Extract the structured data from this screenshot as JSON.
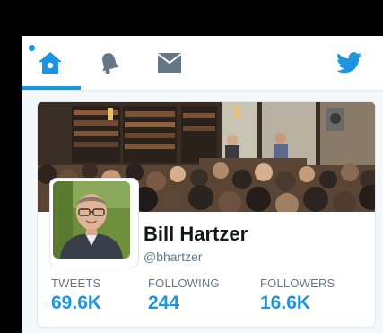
{
  "nav": {
    "items": [
      {
        "icon": "home-icon",
        "active": true
      },
      {
        "icon": "bell-icon",
        "active": false
      },
      {
        "icon": "envelope-icon",
        "active": false
      }
    ],
    "logo_icon": "twitter-bird-icon"
  },
  "colors": {
    "accent": "#1b95e0",
    "text_dark": "#14171a",
    "text_muted": "#657786",
    "nav_icon": "#657786",
    "background": "#000000"
  },
  "profile": {
    "name": "Bill Hartzer",
    "handle": "@bhartzer"
  },
  "stats": [
    {
      "label": "TWEETS",
      "value": "69.6K"
    },
    {
      "label": "FOLLOWING",
      "value": "244"
    },
    {
      "label": "FOLLOWERS",
      "value": "16.6K"
    }
  ]
}
